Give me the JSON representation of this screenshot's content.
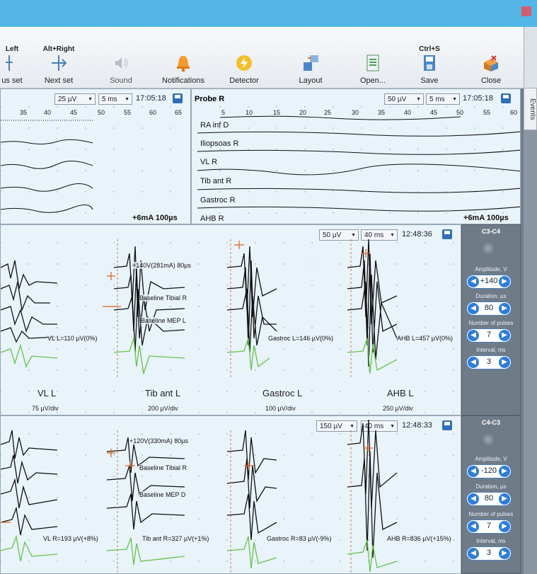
{
  "colors": {
    "titlebar": "#54b6e6",
    "panel_bg": "#e9f3fa",
    "trace": "#111111",
    "mep_trace": "#66c24a",
    "marker": "#e0601a",
    "save_icon": "#2f6fb8"
  },
  "toolbar": {
    "buttons": [
      {
        "shortcut": "Left",
        "label": "us set",
        "icon": "arrow-left-icon"
      },
      {
        "shortcut": "Alt+Right",
        "label": "Next set",
        "icon": "arrow-right-icon"
      },
      {
        "shortcut": "",
        "label": "Sound",
        "icon": "speaker-icon"
      },
      {
        "shortcut": "",
        "label": "Notifications",
        "icon": "bell-icon"
      },
      {
        "shortcut": "",
        "label": "Detector",
        "icon": "lightning-icon"
      },
      {
        "shortcut": "",
        "label": "Layout",
        "icon": "layout-icon"
      },
      {
        "shortcut": "",
        "label": "Open...",
        "icon": "open-document-icon"
      },
      {
        "shortcut": "Ctrl+S",
        "label": "Save",
        "icon": "save-icon"
      },
      {
        "shortcut": "",
        "label": "Close",
        "icon": "close-box-icon"
      }
    ]
  },
  "events_tab": "Events",
  "probe_left": {
    "amp": "25 µV",
    "time": "5 ms",
    "timestamp": "17:05:18",
    "ticks": [
      "35",
      "40",
      "45",
      "50",
      "55",
      "60",
      "65"
    ],
    "footer": "+6mA 100µs"
  },
  "probe_right": {
    "title": "Probe R",
    "amp": "50 µV",
    "time": "5 ms",
    "timestamp": "17:05:18",
    "ticks": [
      "5",
      "10",
      "15",
      "20",
      "25",
      "30",
      "35",
      "40",
      "45",
      "50",
      "55",
      "60"
    ],
    "traces": [
      "RA inf D",
      "Iliopsoas R",
      "VL R",
      "Tib ant R",
      "Gastroc R",
      "AHB R"
    ],
    "footer": "+6mA 100µs"
  },
  "mep_top": {
    "amp": "50 µV",
    "time": "40 ms",
    "timestamp": "12:48:36",
    "annotations": [
      "+140V(281mA) 80µs",
      "Baseline Tibial R",
      "Baseline MEP L",
      "VL L=110 µV(0%)",
      "Gastroc L=146 µV(0%)",
      "AHB L=457 µV(0%)"
    ],
    "channels": [
      "VL L",
      "Tib ant L",
      "Gastroc L",
      "AHB L"
    ],
    "scales": [
      "75 µV/div",
      "200 µV/div",
      "100 µV/div",
      "250 µV/div"
    ]
  },
  "mep_bottom": {
    "amp": "150 µV",
    "time": "40 ms",
    "timestamp": "12:48:33",
    "annotations": [
      "+120V(330mA) 80µs",
      "Baseline Tibial R",
      "Baseline MEP D",
      "VL R=193 µV(+8%)",
      "Tib ant R=327 µV(+1%)",
      "Gastroc R=83 µV(-9%)",
      "AHB R=836 µV(+15%)"
    ]
  },
  "stim_top": {
    "title": "C3-C4",
    "amplitude_label": "Amplitude, V",
    "amplitude": "+140",
    "duration_label": "Duration, µs",
    "duration": "80",
    "pulses_label": "Number of pulses",
    "pulses": "7",
    "interval_label": "Interval, ms",
    "interval": "3"
  },
  "stim_bottom": {
    "title": "C4-C3",
    "amplitude_label": "Amplitude, V",
    "amplitude": "-120",
    "duration_label": "Duration, µs",
    "duration": "80",
    "pulses_label": "Number of pulses",
    "pulses": "7",
    "interval_label": "Interval, ms",
    "interval": "3"
  }
}
